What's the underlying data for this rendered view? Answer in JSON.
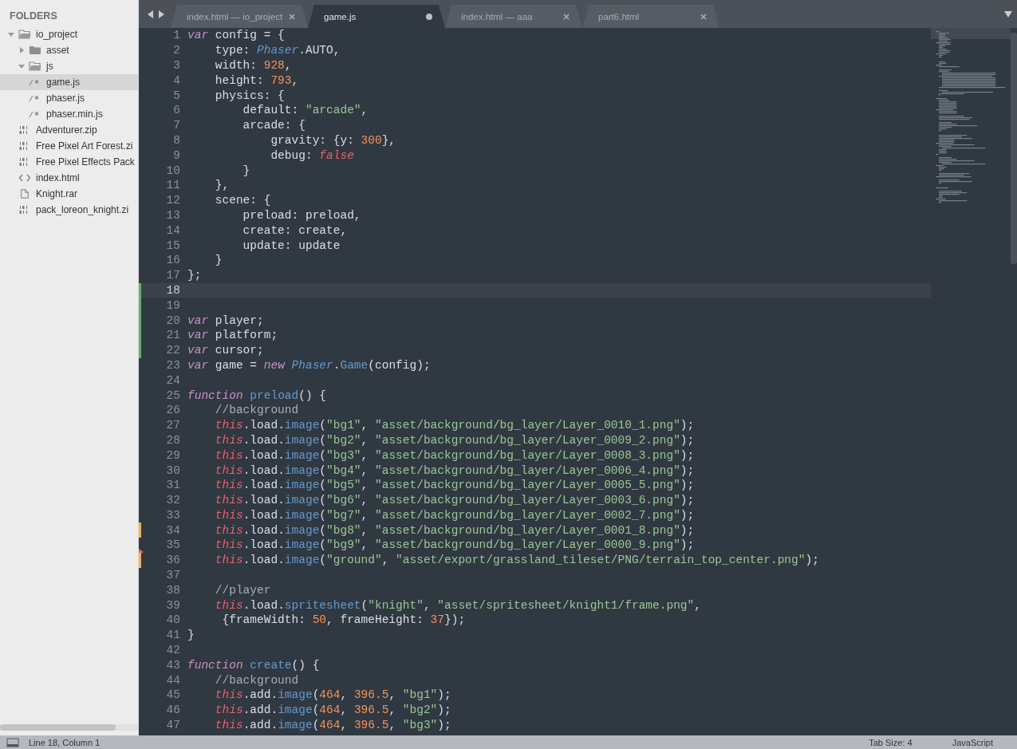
{
  "sidebar": {
    "heading": "FOLDERS",
    "items": [
      {
        "label": "io_project",
        "kind": "folder",
        "expanded": true,
        "selected": false,
        "children": [
          {
            "label": "asset",
            "kind": "folder",
            "expanded": false,
            "selected": false
          },
          {
            "label": "js",
            "kind": "folder",
            "expanded": true,
            "selected": false,
            "children": [
              {
                "label": "game.js",
                "kind": "js",
                "selected": true
              },
              {
                "label": "phaser.js",
                "kind": "js",
                "selected": false
              },
              {
                "label": "phaser.min.js",
                "kind": "js",
                "selected": false
              }
            ]
          },
          {
            "label": "Adventurer.zip",
            "kind": "binary",
            "selected": false
          },
          {
            "label": "Free Pixel Art Forest.zi",
            "kind": "binary",
            "selected": false
          },
          {
            "label": "Free Pixel Effects Pack",
            "kind": "binary",
            "selected": false
          },
          {
            "label": "index.html",
            "kind": "html",
            "selected": false
          },
          {
            "label": "Knight.rar",
            "kind": "document",
            "selected": false
          },
          {
            "label": "pack_loreon_knight.zi",
            "kind": "binary",
            "selected": false
          }
        ]
      }
    ]
  },
  "tabs": [
    {
      "label": "index.html — io_project",
      "selected": false,
      "modified": false
    },
    {
      "label": "game.js",
      "selected": true,
      "modified": true
    },
    {
      "label": "index.html — aaa",
      "selected": false,
      "modified": false
    },
    {
      "label": "part6.html",
      "selected": false,
      "modified": false
    }
  ],
  "code": [
    {
      "num": "1",
      "tokens": [
        {
          "kind": "keyword",
          "t": "var"
        },
        {
          "kind": "plain",
          "t": " config = {"
        }
      ]
    },
    {
      "num": "2",
      "tokens": [
        {
          "kind": "plain",
          "t": "    type: "
        },
        {
          "kind": "type",
          "t": "Phaser"
        },
        {
          "kind": "plain",
          "t": ".AUTO,"
        }
      ]
    },
    {
      "num": "3",
      "tokens": [
        {
          "kind": "plain",
          "t": "    width: "
        },
        {
          "kind": "number",
          "t": "928"
        },
        {
          "kind": "plain",
          "t": ","
        }
      ]
    },
    {
      "num": "4",
      "tokens": [
        {
          "kind": "plain",
          "t": "    height: "
        },
        {
          "kind": "number",
          "t": "793"
        },
        {
          "kind": "plain",
          "t": ","
        }
      ]
    },
    {
      "num": "5",
      "tokens": [
        {
          "kind": "plain",
          "t": "    physics: {"
        }
      ]
    },
    {
      "num": "6",
      "tokens": [
        {
          "kind": "plain",
          "t": "        default: "
        },
        {
          "kind": "string",
          "t": "\"arcade\""
        },
        {
          "kind": "plain",
          "t": ","
        }
      ]
    },
    {
      "num": "7",
      "tokens": [
        {
          "kind": "plain",
          "t": "        arcade: {"
        }
      ]
    },
    {
      "num": "8",
      "tokens": [
        {
          "kind": "plain",
          "t": "            gravity: {y: "
        },
        {
          "kind": "number",
          "t": "300"
        },
        {
          "kind": "plain",
          "t": "},"
        }
      ]
    },
    {
      "num": "9",
      "tokens": [
        {
          "kind": "plain",
          "t": "            debug: "
        },
        {
          "kind": "boolean",
          "t": "false"
        }
      ]
    },
    {
      "num": "10",
      "tokens": [
        {
          "kind": "plain",
          "t": "        }"
        }
      ]
    },
    {
      "num": "11",
      "tokens": [
        {
          "kind": "plain",
          "t": "    },"
        }
      ]
    },
    {
      "num": "12",
      "tokens": [
        {
          "kind": "plain",
          "t": "    scene: {"
        }
      ]
    },
    {
      "num": "13",
      "tokens": [
        {
          "kind": "plain",
          "t": "        preload: preload,"
        }
      ]
    },
    {
      "num": "14",
      "tokens": [
        {
          "kind": "plain",
          "t": "        create: create,"
        }
      ]
    },
    {
      "num": "15",
      "tokens": [
        {
          "kind": "plain",
          "t": "        update: update"
        }
      ]
    },
    {
      "num": "16",
      "tokens": [
        {
          "kind": "plain",
          "t": "    }"
        }
      ]
    },
    {
      "num": "17",
      "tokens": [
        {
          "kind": "plain",
          "t": "};"
        }
      ]
    },
    {
      "num": "18",
      "current": true,
      "kind": "added"
    },
    {
      "num": "19",
      "kind": "added"
    },
    {
      "num": "20",
      "kind": "added",
      "tokens": [
        {
          "kind": "keyword",
          "t": "var"
        },
        {
          "kind": "plain",
          "t": " player;"
        }
      ]
    },
    {
      "num": "21",
      "kind": "added",
      "tokens": [
        {
          "kind": "keyword",
          "t": "var"
        },
        {
          "kind": "plain",
          "t": " platform;"
        }
      ]
    },
    {
      "num": "22",
      "kind": "added",
      "tokens": [
        {
          "kind": "keyword",
          "t": "var"
        },
        {
          "kind": "plain",
          "t": " cursor;"
        }
      ]
    },
    {
      "num": "23",
      "tokens": [
        {
          "kind": "keyword",
          "t": "var"
        },
        {
          "kind": "plain",
          "t": " game = "
        },
        {
          "kind": "keyword",
          "t": "new "
        },
        {
          "kind": "type",
          "t": "Phaser"
        },
        {
          "kind": "plain",
          "t": "."
        },
        {
          "kind": "function",
          "t": "Game"
        },
        {
          "kind": "plain",
          "t": "(config);"
        }
      ]
    },
    {
      "num": "24"
    },
    {
      "num": "25",
      "tokens": [
        {
          "kind": "keyword",
          "t": "function "
        },
        {
          "kind": "function",
          "t": "preload"
        },
        {
          "kind": "plain",
          "t": "() {"
        }
      ]
    },
    {
      "num": "26",
      "tokens": [
        {
          "kind": "comment",
          "t": "    //background"
        }
      ]
    },
    {
      "num": "27",
      "tokens": [
        {
          "kind": "this",
          "t": "    this"
        },
        {
          "kind": "plain",
          "t": ".load."
        },
        {
          "kind": "function",
          "t": "image"
        },
        {
          "kind": "plain",
          "t": "("
        },
        {
          "kind": "string",
          "t": "\"bg1\""
        },
        {
          "kind": "plain",
          "t": ", "
        },
        {
          "kind": "string",
          "t": "\"asset/background/bg_layer/Layer_0010_1.png\""
        },
        {
          "kind": "plain",
          "t": ");"
        }
      ]
    },
    {
      "num": "28",
      "tokens": [
        {
          "kind": "this",
          "t": "    this"
        },
        {
          "kind": "plain",
          "t": ".load."
        },
        {
          "kind": "function",
          "t": "image"
        },
        {
          "kind": "plain",
          "t": "("
        },
        {
          "kind": "string",
          "t": "\"bg2\""
        },
        {
          "kind": "plain",
          "t": ", "
        },
        {
          "kind": "string",
          "t": "\"asset/background/bg_layer/Layer_0009_2.png\""
        },
        {
          "kind": "plain",
          "t": ");"
        }
      ]
    },
    {
      "num": "29",
      "tokens": [
        {
          "kind": "this",
          "t": "    this"
        },
        {
          "kind": "plain",
          "t": ".load."
        },
        {
          "kind": "function",
          "t": "image"
        },
        {
          "kind": "plain",
          "t": "("
        },
        {
          "kind": "string",
          "t": "\"bg3\""
        },
        {
          "kind": "plain",
          "t": ", "
        },
        {
          "kind": "string",
          "t": "\"asset/background/bg_layer/Layer_0008_3.png\""
        },
        {
          "kind": "plain",
          "t": ");"
        }
      ]
    },
    {
      "num": "30",
      "tokens": [
        {
          "kind": "this",
          "t": "    this"
        },
        {
          "kind": "plain",
          "t": ".load."
        },
        {
          "kind": "function",
          "t": "image"
        },
        {
          "kind": "plain",
          "t": "("
        },
        {
          "kind": "string",
          "t": "\"bg4\""
        },
        {
          "kind": "plain",
          "t": ", "
        },
        {
          "kind": "string",
          "t": "\"asset/background/bg_layer/Layer_0006_4.png\""
        },
        {
          "kind": "plain",
          "t": ");"
        }
      ]
    },
    {
      "num": "31",
      "tokens": [
        {
          "kind": "this",
          "t": "    this"
        },
        {
          "kind": "plain",
          "t": ".load."
        },
        {
          "kind": "function",
          "t": "image"
        },
        {
          "kind": "plain",
          "t": "("
        },
        {
          "kind": "string",
          "t": "\"bg5\""
        },
        {
          "kind": "plain",
          "t": ", "
        },
        {
          "kind": "string",
          "t": "\"asset/background/bg_layer/Layer_0005_5.png\""
        },
        {
          "kind": "plain",
          "t": ");"
        }
      ]
    },
    {
      "num": "32",
      "tokens": [
        {
          "kind": "this",
          "t": "    this"
        },
        {
          "kind": "plain",
          "t": ".load."
        },
        {
          "kind": "function",
          "t": "image"
        },
        {
          "kind": "plain",
          "t": "("
        },
        {
          "kind": "string",
          "t": "\"bg6\""
        },
        {
          "kind": "plain",
          "t": ", "
        },
        {
          "kind": "string",
          "t": "\"asset/background/bg_layer/Layer_0003_6.png\""
        },
        {
          "kind": "plain",
          "t": ");"
        }
      ]
    },
    {
      "num": "33",
      "tokens": [
        {
          "kind": "this",
          "t": "    this"
        },
        {
          "kind": "plain",
          "t": ".load."
        },
        {
          "kind": "function",
          "t": "image"
        },
        {
          "kind": "plain",
          "t": "("
        },
        {
          "kind": "string",
          "t": "\"bg7\""
        },
        {
          "kind": "plain",
          "t": ", "
        },
        {
          "kind": "string",
          "t": "\"asset/background/bg_layer/Layer_0002_7.png\""
        },
        {
          "kind": "plain",
          "t": ");"
        }
      ]
    },
    {
      "num": "34",
      "kind": "modified",
      "tokens": [
        {
          "kind": "this",
          "t": "    this"
        },
        {
          "kind": "plain",
          "t": ".load."
        },
        {
          "kind": "function",
          "t": "image"
        },
        {
          "kind": "plain",
          "t": "("
        },
        {
          "kind": "string",
          "t": "\"bg8\""
        },
        {
          "kind": "plain",
          "t": ", "
        },
        {
          "kind": "string",
          "t": "\"asset/background/bg_layer/Layer_0001_8.png\""
        },
        {
          "kind": "plain",
          "t": ");"
        }
      ]
    },
    {
      "num": "35",
      "kind": "deleted",
      "tokens": [
        {
          "kind": "this",
          "t": "    this"
        },
        {
          "kind": "plain",
          "t": ".load."
        },
        {
          "kind": "function",
          "t": "image"
        },
        {
          "kind": "plain",
          "t": "("
        },
        {
          "kind": "string",
          "t": "\"bg9\""
        },
        {
          "kind": "plain",
          "t": ", "
        },
        {
          "kind": "string",
          "t": "\"asset/background/bg_layer/Layer_0000_9.png\""
        },
        {
          "kind": "plain",
          "t": ");"
        }
      ]
    },
    {
      "num": "36",
      "kind": "modified",
      "tokens": [
        {
          "kind": "this",
          "t": "    this"
        },
        {
          "kind": "plain",
          "t": ".load."
        },
        {
          "kind": "function",
          "t": "image"
        },
        {
          "kind": "plain",
          "t": "("
        },
        {
          "kind": "string",
          "t": "\"ground\""
        },
        {
          "kind": "plain",
          "t": ", "
        },
        {
          "kind": "string",
          "t": "\"asset/export/grassland_tileset/PNG/terrain_top_center.png\""
        },
        {
          "kind": "plain",
          "t": ");"
        }
      ]
    },
    {
      "num": "37"
    },
    {
      "num": "38",
      "tokens": [
        {
          "kind": "comment",
          "t": "    //player"
        }
      ]
    },
    {
      "num": "39",
      "tokens": [
        {
          "kind": "this",
          "t": "    this"
        },
        {
          "kind": "plain",
          "t": ".load."
        },
        {
          "kind": "function",
          "t": "spritesheet"
        },
        {
          "kind": "plain",
          "t": "("
        },
        {
          "kind": "string",
          "t": "\"knight\""
        },
        {
          "kind": "plain",
          "t": ", "
        },
        {
          "kind": "string",
          "t": "\"asset/spritesheet/knight1/frame.png\""
        },
        {
          "kind": "plain",
          "t": ","
        }
      ]
    },
    {
      "num": "40",
      "tokens": [
        {
          "kind": "plain",
          "t": "     {frameWidth: "
        },
        {
          "kind": "number",
          "t": "50"
        },
        {
          "kind": "plain",
          "t": ", frameHeight: "
        },
        {
          "kind": "number",
          "t": "37"
        },
        {
          "kind": "plain",
          "t": "});"
        }
      ]
    },
    {
      "num": "41",
      "tokens": [
        {
          "kind": "plain",
          "t": "}"
        }
      ]
    },
    {
      "num": "42"
    },
    {
      "num": "43",
      "tokens": [
        {
          "kind": "keyword",
          "t": "function "
        },
        {
          "kind": "function",
          "t": "create"
        },
        {
          "kind": "plain",
          "t": "() {"
        }
      ]
    },
    {
      "num": "44",
      "tokens": [
        {
          "kind": "comment",
          "t": "    //background"
        }
      ]
    },
    {
      "num": "45",
      "tokens": [
        {
          "kind": "this",
          "t": "    this"
        },
        {
          "kind": "plain",
          "t": ".add."
        },
        {
          "kind": "function",
          "t": "image"
        },
        {
          "kind": "plain",
          "t": "("
        },
        {
          "kind": "number",
          "t": "464"
        },
        {
          "kind": "plain",
          "t": ", "
        },
        {
          "kind": "number",
          "t": "396.5"
        },
        {
          "kind": "plain",
          "t": ", "
        },
        {
          "kind": "string",
          "t": "\"bg1\""
        },
        {
          "kind": "plain",
          "t": ");"
        }
      ]
    },
    {
      "num": "46",
      "tokens": [
        {
          "kind": "this",
          "t": "    this"
        },
        {
          "kind": "plain",
          "t": ".add."
        },
        {
          "kind": "function",
          "t": "image"
        },
        {
          "kind": "plain",
          "t": "("
        },
        {
          "kind": "number",
          "t": "464"
        },
        {
          "kind": "plain",
          "t": ", "
        },
        {
          "kind": "number",
          "t": "396.5"
        },
        {
          "kind": "plain",
          "t": ", "
        },
        {
          "kind": "string",
          "t": "\"bg2\""
        },
        {
          "kind": "plain",
          "t": ");"
        }
      ]
    },
    {
      "num": "47",
      "tokens": [
        {
          "kind": "this",
          "t": "    this"
        },
        {
          "kind": "plain",
          "t": ".add."
        },
        {
          "kind": "function",
          "t": "image"
        },
        {
          "kind": "plain",
          "t": "("
        },
        {
          "kind": "number",
          "t": "464"
        },
        {
          "kind": "plain",
          "t": ", "
        },
        {
          "kind": "number",
          "t": "396.5"
        },
        {
          "kind": "plain",
          "t": ", "
        },
        {
          "kind": "string",
          "t": "\"bg3\""
        },
        {
          "kind": "plain",
          "t": ");"
        }
      ]
    }
  ],
  "status_bar": {
    "position": "Line 18, Column 1",
    "tab_size": "Tab Size: 4",
    "syntax": "JavaScript"
  }
}
